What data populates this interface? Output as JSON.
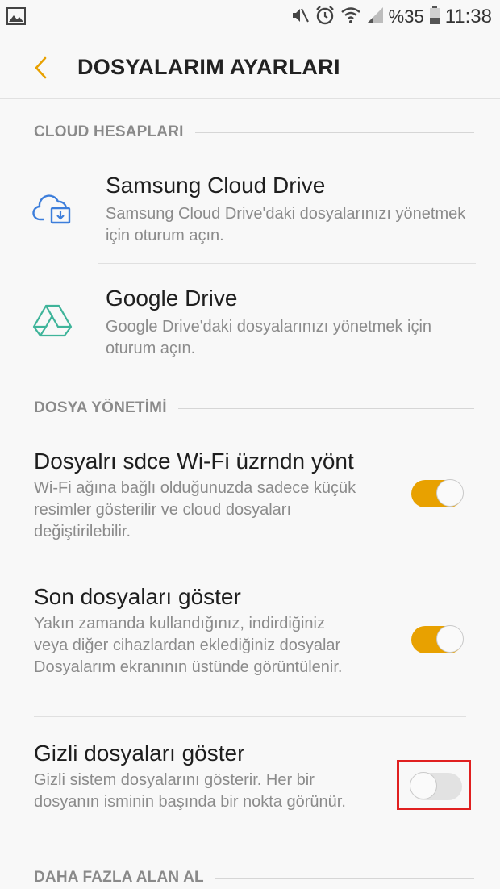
{
  "status_bar": {
    "battery": "%35",
    "time": "11:38",
    "icons": [
      "image-icon",
      "mute-icon",
      "alarm-icon",
      "wifi-icon",
      "signal-icon",
      "battery-icon"
    ]
  },
  "app_bar": {
    "title": "DOSYALARIM AYARLARI"
  },
  "cloud_section": {
    "header": "CLOUD HESAPLARI",
    "items": [
      {
        "title": "Samsung Cloud Drive",
        "subtitle": "Samsung Cloud Drive'daki dosyalarınızı yönetmek için oturum açın.",
        "icon": "samsung-cloud-icon",
        "icon_color": "#3d7edb"
      },
      {
        "title": "Google Drive",
        "subtitle": "Google Drive'daki dosyalarınızı yönetmek için oturum açın.",
        "icon": "google-drive-icon",
        "icon_color": "#3fb49a"
      }
    ]
  },
  "file_section": {
    "header": "DOSYA YÖNETİMİ",
    "items": [
      {
        "title": "Dosyalrı sdce Wi-Fi üzrndn yönt",
        "subtitle": "Wi-Fi ağına bağlı olduğunuzda sadece küçük resimler gösterilir ve cloud dosyaları değiştirilebilir.",
        "toggle": "on"
      },
      {
        "title": "Son dosyaları göster",
        "subtitle": "Yakın zamanda kullandığınız, indirdiğiniz veya diğer cihazlardan eklediğiniz dosyalar Dosyalarım ekranının üstünde görüntülenir.",
        "toggle": "on"
      },
      {
        "title": "Gizli dosyaları göster",
        "subtitle": "Gizli sistem dosyalarını gösterir. Her bir dosyanın isminin başında bir nokta görünür.",
        "toggle": "off"
      }
    ]
  },
  "storage_section": {
    "header": "DAHA FAZLA ALAN AL"
  },
  "colors": {
    "accent": "#e8a100",
    "highlight": "#e02020",
    "background": "#f8f8f8"
  }
}
